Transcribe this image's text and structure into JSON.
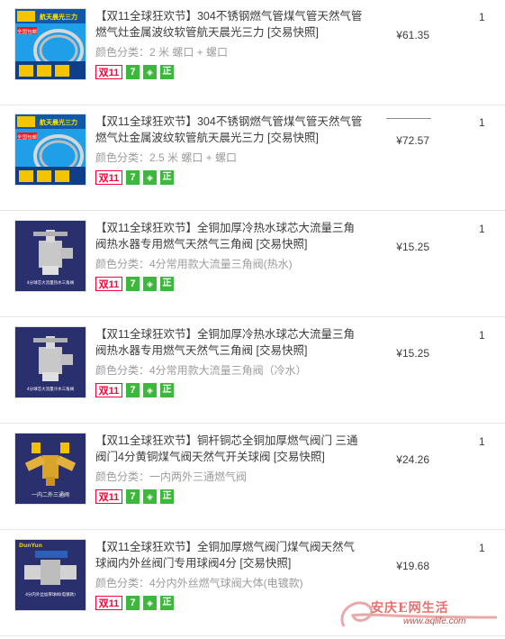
{
  "items": [
    {
      "title": "【双11全球狂欢节】304不锈钢燃气管煤气管天然气管燃气灶金属波纹软管航天晨光三力 [交易快照]",
      "sku": "颜色分类：2 米 螺口 + 螺口",
      "price": "¥61.35",
      "qty": "1",
      "show_orig_line": false,
      "thumb": {
        "kind": "hose",
        "brand": "航天晨光三力",
        "note": "全国包邮",
        "bg": "#1e9fe8"
      }
    },
    {
      "title": "【双11全球狂欢节】304不锈钢燃气管煤气管天然气管燃气灶金属波纹软管航天晨光三力 [交易快照]",
      "sku": "颜色分类：2.5 米 螺口 + 螺口",
      "price": "¥72.57",
      "qty": "1",
      "show_orig_line": true,
      "thumb": {
        "kind": "hose",
        "brand": "航天晨光三力",
        "note": "全国包邮",
        "bg": "#1e9fe8"
      }
    },
    {
      "title": "【双11全球狂欢节】全铜加厚冷热水球芯大流量三角阀热水器专用燃气天然气三角阀 [交易快照]",
      "sku": "颜色分类：4分常用款大流量三角阀(热水)",
      "price": "¥15.25",
      "qty": "1",
      "show_orig_line": false,
      "thumb": {
        "kind": "valve",
        "caption": "4分球芯大流量热水三角阀",
        "bg": "#2a2f6e"
      }
    },
    {
      "title": "【双11全球狂欢节】全铜加厚冷热水球芯大流量三角阀热水器专用燃气天然气三角阀 [交易快照]",
      "sku": "颜色分类：4分常用款大流量三角阀（冷水）",
      "price": "¥15.25",
      "qty": "1",
      "show_orig_line": false,
      "thumb": {
        "kind": "valve",
        "caption": "4分球芯大流量冷水三角阀",
        "bg": "#2a2f6e"
      }
    },
    {
      "title": "【双11全球狂欢节】铜杆铜芯全铜加厚燃气阀门 三通阀门4分黄铜煤气阀天然气开关球阀 [交易快照]",
      "sku": "颜色分类：一内两外三通燃气阀",
      "price": "¥24.26",
      "qty": "1",
      "show_orig_line": false,
      "thumb": {
        "kind": "tee",
        "caption": "一内二外三通阀",
        "bg": "#2a2f6e"
      }
    },
    {
      "title": "【双11全球狂欢节】全铜加厚燃气阀门煤气阀天然气球阀内外丝阀门专用球阀4分 [交易快照]",
      "sku": "颜色分类：4分内外丝燃气球阀大体(电镀款)",
      "price": "¥19.68",
      "qty": "1",
      "show_orig_line": false,
      "thumb": {
        "kind": "ball",
        "caption": "4分内外丝加厚球阀(电镀款)",
        "brand": "DunYun",
        "bg": "#2a2f6e"
      }
    }
  ],
  "badges": {
    "double11": "双11",
    "seven": "7",
    "bag": "◈",
    "genuine": "正"
  },
  "watermark": {
    "text": "安庆E网生活",
    "url": "www.aqlife.com"
  }
}
